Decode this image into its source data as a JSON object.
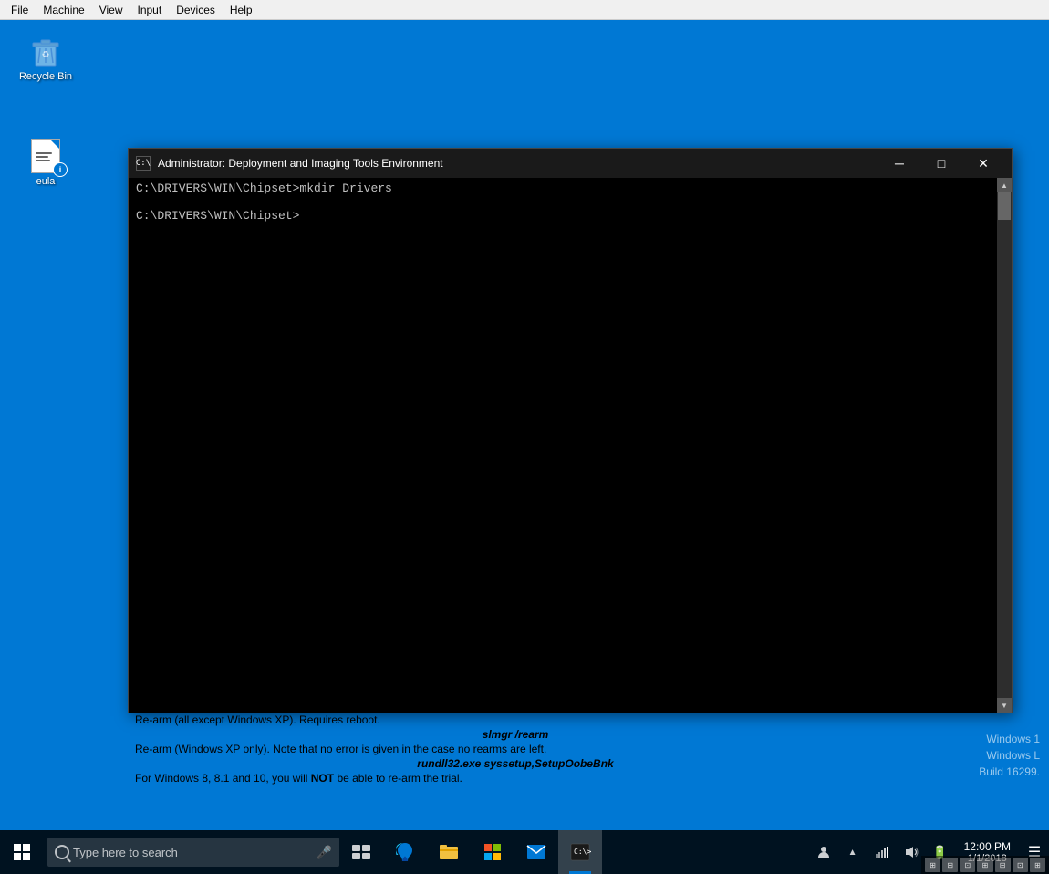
{
  "menubar": {
    "items": [
      "File",
      "Machine",
      "View",
      "Input",
      "Devices",
      "Help"
    ]
  },
  "desktop": {
    "background_color": "#0078d4",
    "icons": [
      {
        "id": "recycle-bin",
        "label": "Recycle Bin",
        "type": "recycle"
      },
      {
        "id": "eula",
        "label": "eula",
        "type": "file"
      }
    ]
  },
  "cmd_window": {
    "title": "Administrator: Deployment and Imaging Tools Environment",
    "icon_label": "C:\\",
    "lines": [
      "C:\\DRIVERS\\WIN\\Chipset>mkdir Drivers",
      "",
      "C:\\DRIVERS\\WIN\\Chipset>"
    ],
    "controls": {
      "minimize": "─",
      "maximize": "□",
      "close": "✕"
    }
  },
  "info_panel": {
    "line1": "Re-arm (all except Windows XP). Requires reboot.",
    "line2_italic": "slmgr /rearm",
    "line3": "Re-arm (Windows XP only). Note that no error is given in the case no rearms are left.",
    "line4_italic": "rundll32.exe syssetup,SetupOobeBnk",
    "line5_pre": "For Windows 8, 8.1 and 10, you will ",
    "line5_bold": "NOT",
    "line5_post": " be able to re-arm the trial."
  },
  "watermark": {
    "line1": "Windows 1",
    "line2": "Windows L",
    "line3": "Build 16299."
  },
  "taskbar": {
    "search_placeholder": "Type here to search",
    "apps": [
      {
        "id": "task-view",
        "label": "Task View",
        "icon": "task-view"
      },
      {
        "id": "edge",
        "label": "Microsoft Edge",
        "icon": "edge"
      },
      {
        "id": "explorer",
        "label": "File Explorer",
        "icon": "explorer"
      },
      {
        "id": "store",
        "label": "Microsoft Store",
        "icon": "store"
      },
      {
        "id": "mail",
        "label": "Mail",
        "icon": "mail"
      },
      {
        "id": "cmd",
        "label": "Command Prompt",
        "icon": "cmd",
        "active": true
      }
    ],
    "tray": {
      "icons": [
        "people",
        "chevron",
        "network",
        "volume",
        "battery"
      ],
      "time": "▲",
      "clock_time": "",
      "clock_date": ""
    }
  },
  "bottom_strip": {
    "icons": [
      "icon1",
      "icon2",
      "icon3",
      "icon4",
      "icon5",
      "icon6",
      "icon7"
    ]
  }
}
